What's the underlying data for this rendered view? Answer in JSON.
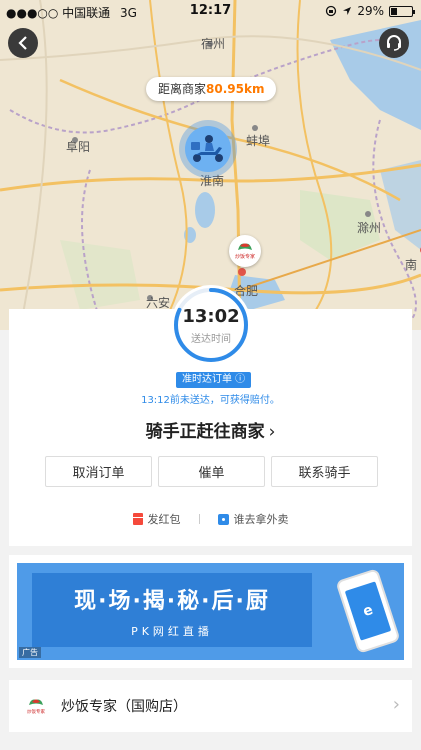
{
  "status_bar": {
    "carrier": "●●●○○ 中国联通",
    "network": "3G",
    "time": "12:17",
    "battery": "29%"
  },
  "map": {
    "distance_label": "距离商家",
    "distance_value": "80.95km",
    "places": [
      "宿州",
      "阜阳",
      "蚌埠",
      "淮南",
      "滁州",
      "六安",
      "合肥",
      "南"
    ]
  },
  "shop_marker_text": "炒饭专家",
  "order": {
    "eta_time": "13:02",
    "eta_label": "送达时间",
    "ontime_badge": "准时达订单 ⓘ",
    "ontime_note": "13:12前未送达，可获得赔付。",
    "rider_status": "骑手正赶往商家",
    "rider_status_chevron": "›",
    "buttons": {
      "cancel": "取消订单",
      "urge": "催单",
      "contact": "联系骑手"
    },
    "extras": {
      "red_packet": "发红包",
      "who_fetch": "谁去拿外卖"
    },
    "progress": 0.82,
    "accent_color": "#2f8be8"
  },
  "banner": {
    "title": "现·场·揭·秘·后·厨",
    "subtitle": "PK网红直播",
    "ad_tag": "广告",
    "phone_letter": "e"
  },
  "shop": {
    "name": "炒饭专家（国购店）",
    "logo_text": "炒饭专家",
    "chevron": "›"
  }
}
